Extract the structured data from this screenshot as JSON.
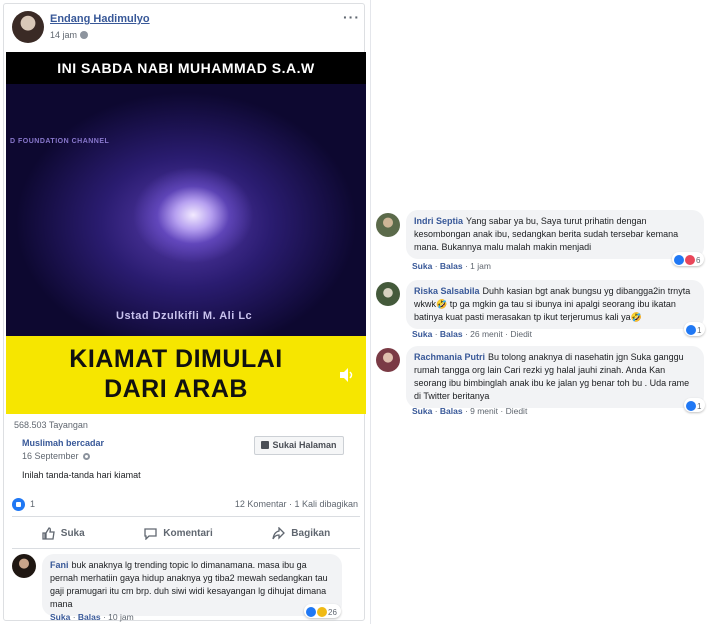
{
  "post": {
    "author": "Endang Hadimulyo",
    "time": "14 jam",
    "more": "···",
    "video": {
      "top_text": "INI SABDA NABI MUHAMMAD S.A.W",
      "channel_text": "D FOUNDATION CHANNEL",
      "ustad": "Ustad Dzulkifli M. Ali Lc",
      "headline_line1": "KIAMAT DIMULAI",
      "headline_line2": "DARI ARAB"
    },
    "views": "568.503 Tayangan",
    "shared": {
      "page_name": "Muslimah bercadar",
      "date": "16 September",
      "like_page_label": "Sukai Halaman",
      "caption": "Inilah tanda-tanda hari kiamat"
    },
    "stats": {
      "likes": "1",
      "comments_shares": "12 Komentar · 1 Kali dibagikan"
    },
    "actions": {
      "like": "Suka",
      "comment": "Komentari",
      "share": "Bagikan"
    },
    "comment": {
      "name": "Fani",
      "text": "buk anaknya lg trending topic lo dimanamana. masa ibu ga pernah merhatiin gaya hidup anaknya yg tiba2 mewah sedangkan tau gaji pramugari itu cm brp. duh siwi widi kesayangan lg dihujat dimana mana",
      "like": "Suka",
      "reply": "Balas",
      "time": "10 jam",
      "reactions": "26"
    }
  },
  "right_comments": [
    {
      "name": "Indri Septia",
      "text": "Yang sabar ya bu, Saya turut prihatin dengan kesombongan anak ibu, sedangkan berita sudah tersebar kemana mana. Bukannya malu malah makin menjadi",
      "like": "Suka",
      "reply": "Balas",
      "time": "1 jam",
      "edited": "",
      "reactions": "6"
    },
    {
      "name": "Riska Salsabila",
      "text": "Duhh kasian bgt anak bungsu yg dibangga2in trnyta wkwk🤣 tp ga mgkin ga tau si ibunya ini apalgi seorang ibu ikatan batinya kuat pasti merasakan tp ikut terjerumus kali ya🤣",
      "like": "Suka",
      "reply": "Balas",
      "time": "26 menit",
      "edited": "Diedit",
      "reactions": "1"
    },
    {
      "name": "Rachmania Putri",
      "text": "Bu tolong anaknya di nasehatin jgn Suka ganggu rumah tangga org lain Cari rezki yg halal jauhi zinah. Anda Kan seorang ibu bimbinglah anak ibu ke jalan yg benar toh bu . Uda rame di Twitter beritanya",
      "like": "Suka",
      "reply": "Balas",
      "time": "9 menit",
      "edited": "Diedit",
      "reactions": "1"
    }
  ],
  "colors": {
    "link_blue": "#385898",
    "video_yellow": "#f6e600",
    "like_blue": "#2078f4",
    "bubble_gray": "#f2f3f5"
  }
}
